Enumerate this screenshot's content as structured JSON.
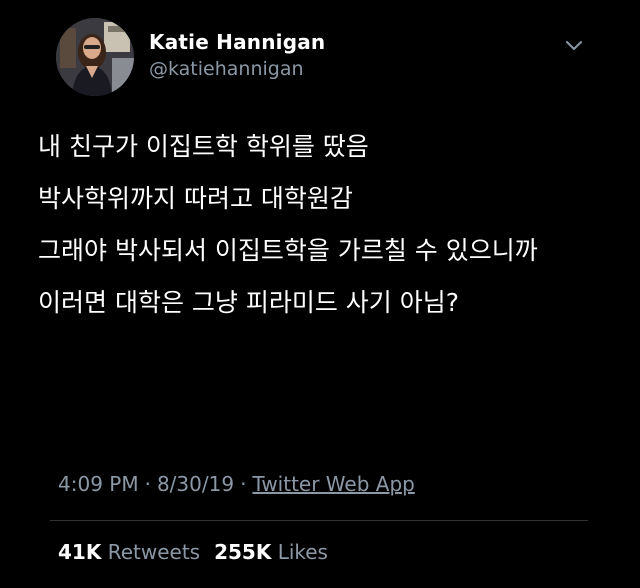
{
  "author": {
    "name": "Katie Hannigan",
    "handle": "@katiehannigan"
  },
  "tweet": {
    "lines": [
      "내 친구가 이집트학 학위를 땄음",
      "박사학위까지 따려고 대학원감",
      "그래야 박사되서 이집트학을 가르칠 수 있으니까",
      "이러면 대학은 그냥 피라미드 사기 아님?"
    ]
  },
  "meta": {
    "time": "4:09 PM",
    "separator": "·",
    "date": "8/30/19",
    "source": "Twitter Web App"
  },
  "stats": {
    "retweets_count": "41K",
    "retweets_label": "Retweets",
    "likes_count": "255K",
    "likes_label": "Likes"
  },
  "icons": {
    "menu": "chevron-down-icon"
  },
  "colors": {
    "background": "#000000",
    "text": "#ffffff",
    "secondary": "#8b98a5",
    "divider": "#2f3336"
  }
}
